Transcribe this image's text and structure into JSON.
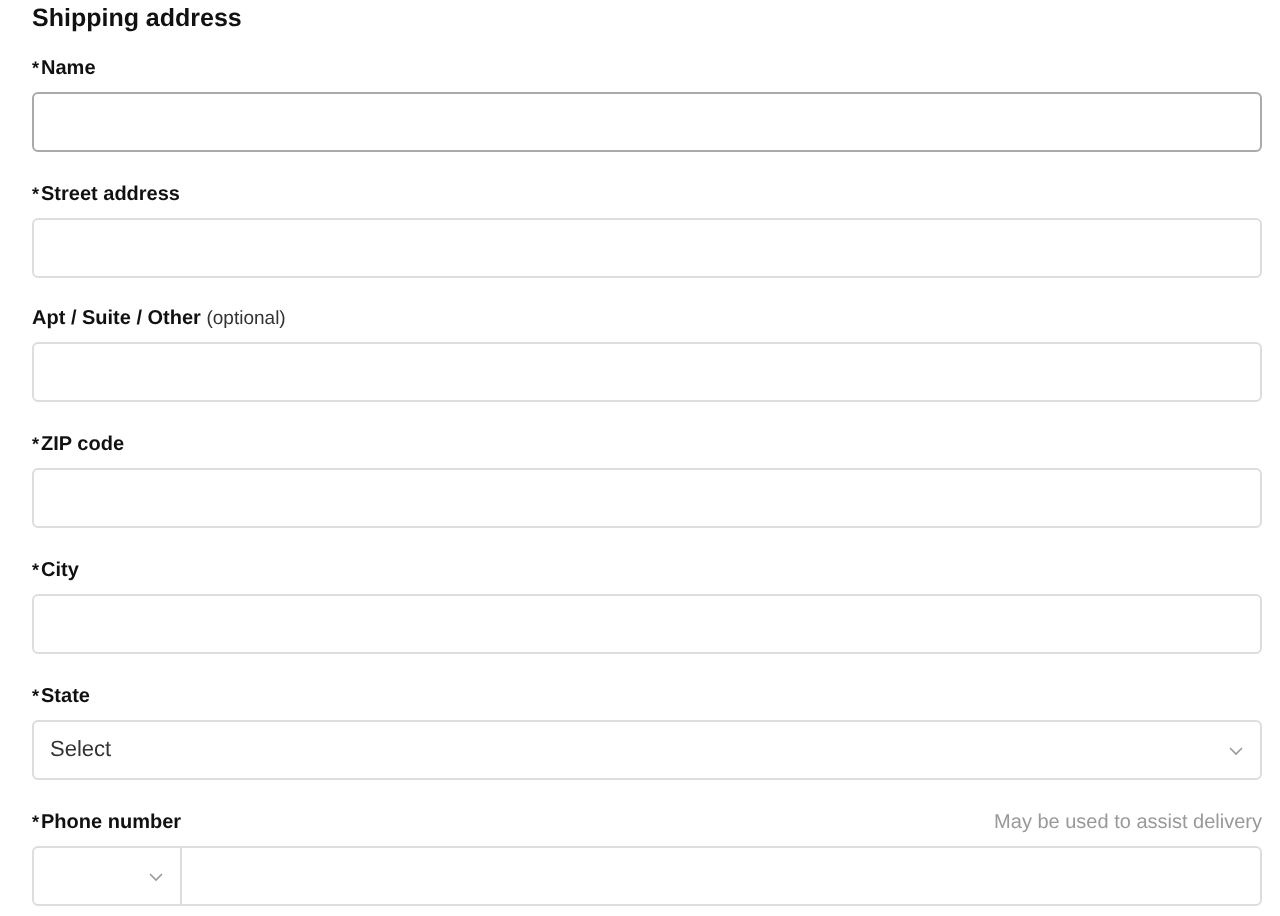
{
  "heading": "Shipping address",
  "fields": [
    {
      "kind": "text",
      "required_mark": "*",
      "label": "Name",
      "focused": true
    },
    {
      "kind": "text",
      "required_mark": "*",
      "label": "Street address",
      "focused": false
    },
    {
      "kind": "text",
      "label": "Apt / Suite / Other",
      "note": "(optional)",
      "focused": false
    },
    {
      "kind": "text",
      "required_mark": "*",
      "label": "ZIP code",
      "focused": false
    },
    {
      "kind": "text",
      "required_mark": "*",
      "label": "City",
      "focused": false
    },
    {
      "kind": "select",
      "required_mark": "*",
      "label": "State",
      "focused": false,
      "placeholder": "Select"
    },
    {
      "kind": "phone",
      "required_mark": "*",
      "label": "Phone number",
      "focused": false,
      "hint": "May be used to assist delivery"
    }
  ]
}
